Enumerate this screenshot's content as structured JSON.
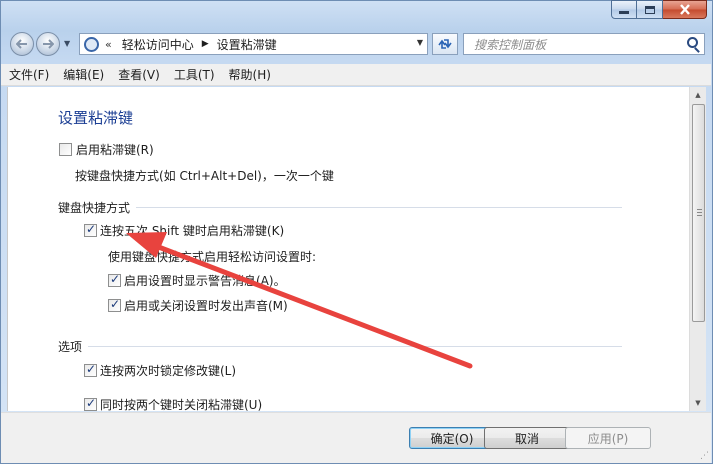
{
  "window": {
    "caption_buttons": {
      "minimize": "minimize-icon",
      "maximize": "maximize-icon",
      "close": "close-icon"
    }
  },
  "nav": {
    "back_icon": "back-arrow-icon",
    "forward_icon": "forward-arrow-icon",
    "address": {
      "overflow": "«",
      "crumbs": [
        "轻松访问中心",
        "设置粘滞键"
      ],
      "separator": "▶"
    },
    "refresh_icon": "refresh-icon",
    "search_placeholder": "搜索控制面板"
  },
  "menu": [
    "文件(F)",
    "编辑(E)",
    "查看(V)",
    "工具(T)",
    "帮助(H)"
  ],
  "content": {
    "title": "设置粘滞键",
    "enable_sticky": {
      "label": "启用粘滞键(R)",
      "checked": false
    },
    "description": "按键盘快捷方式(如 Ctrl+Alt+Del)，一次一个键",
    "shortcut_section": "键盘快捷方式",
    "shift_five": {
      "label": "连按五次 Shift 键时启用粘滞键(K)",
      "checked": true
    },
    "shortcut_hint": "使用键盘快捷方式启用轻松访问设置时:",
    "show_warning": {
      "label": "启用设置时显示警告消息(A)。",
      "checked": true
    },
    "make_sound": {
      "label": "启用或关闭设置时发出声音(M)",
      "checked": true
    },
    "options_section": "选项",
    "lock_modifier": {
      "label": "连按两次时锁定修改键(L)",
      "checked": true
    },
    "turn_off_two": {
      "label": "同时按两个键时关闭粘滞键(U)",
      "checked": true
    }
  },
  "footer": {
    "ok": "确定(O)",
    "cancel": "取消",
    "apply": "应用(P)"
  },
  "annotation": {
    "color": "#e8433e"
  }
}
